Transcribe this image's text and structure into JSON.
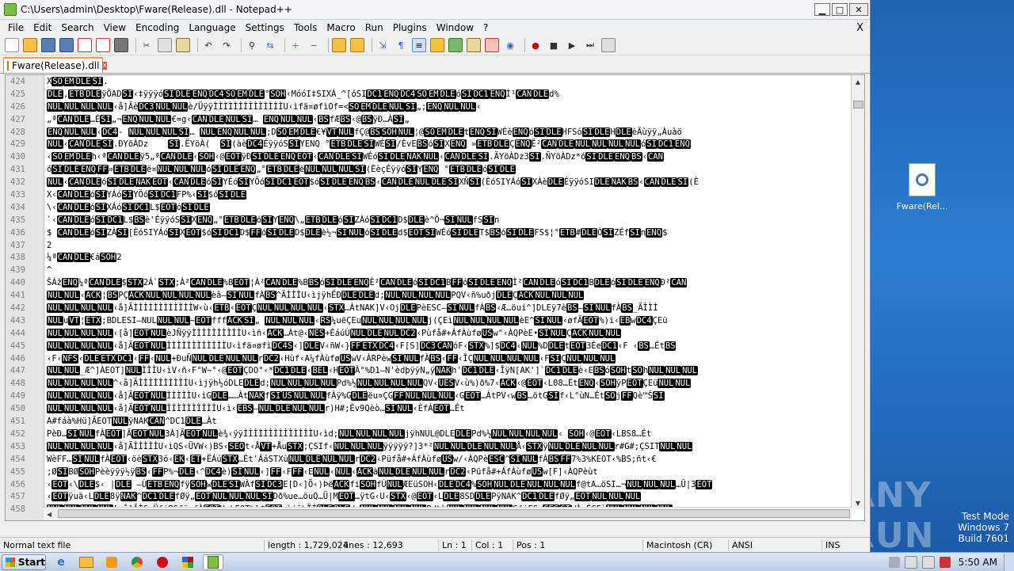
{
  "window": {
    "title": "C:\\Users\\admin\\Desktop\\Fware(Release).dll - Notepad++",
    "minimize": "▁",
    "maximize": "□",
    "close": "✕"
  },
  "menu": [
    "File",
    "Edit",
    "Search",
    "View",
    "Encoding",
    "Language",
    "Settings",
    "Tools",
    "Macro",
    "Run",
    "Plugins",
    "Window",
    "?"
  ],
  "menu_close": "X",
  "tab": {
    "label": "Fware(Release).dll",
    "close": "x"
  },
  "lines": [
    {
      "n": "424",
      "t": "X[SO][EM][DLE][SI]."
    },
    {
      "n": "425",
      "t": "[DLE]‚[ETB][DLE]ÿÖAD[SI]‹‡ÿÿÿó[SI][DLE][ENQ][DC4][SO][EM][DLE]°[SOH]‹MóóI‡SIXÁ_^[óSI[DC1][ENQ][DC4][SO][EM][DLE]ó[SI][DC1][ENQ]Ì¹[CAN][DLE]d%"
    },
    {
      "n": "426",
      "t": "[NUL][NUL][NUL][NUL]‹å]Ãè[DC3][NUL][NUL]è/ÜÿÿÌÌÌÌÌÌÌÌÌÌÌÌÌÌU‹ìfä¤øfìOf=<[SO][EM][DLE][NUL][SI]„;[ENQ][NUL][NUL]‹"
    },
    {
      "n": "427",
      "t": "„ª[CAN][DLE]…É[SI]„¬[ENQ][NUL][NUL]€=g‹[CAN][DLE][NUL][SI]… [ENQ][NUL][NUL]‹[BS]fÆ[BS]‹@[BS]ÿÐ…À[SI]„"
    },
    {
      "n": "428",
      "t": "[ENQ][NUL][NUL]‹[DC4]- [NUL][NUL][NUL][SI]… [NUL][ENQ][NUL][NUL];D[SO][EM][DLE]€¥[VT][NUL]fÇ@[BS][SOH][NUL]¦@[SO][EM][DLE]t[ENQ][SI]WÉè[ENQ]ó[SI][DLE]HFSó[SI][DLE]H[DLE]èÄùÿÿ„Àuàö"
    },
    {
      "n": "429",
      "t": "[NUL]‹[CAN][DLE][SI].ÐYöÀDz    [SI].ËYöÀ(  [SI](àè[DC4]ÉÿÿóS[SI]YENQ °[ETB][DLE][SI]WÉ[SI]/ÈvE[BS]ó[SI]X[ENQ] »[ETB][DLE]Ç[ENQ]Ë²[CAN][DLE][NUL][NUL][NUL][NUL]ó[SI][DC1][ENQ]"
    },
    {
      "n": "430",
      "t": "‹[SO][EM][DLE]h‹ª[CAN][DLE]ÿ5„ª[CAN][DLE]‹[SOH]‹@[EOT]ÿÐ[SI][DLE][ENQ][EOT]‹[CAN][DLE][SI]WÉó[SI][DLE][NAK][NUL]‹[CAN][DLE][SI].ÄYöÀDz3[SI].ÑYöÀDz*ó[SI][DLE][ENQ][BS]‹[CAN]"
    },
    {
      "n": "431",
      "t": "ó[SI][DLE][ENQ][FF]»[ETB][DLE]ë¤[NUL][NUL][NUL]ó[SI][DLE][ENQ]„°[ETB][DLE]ë[NUL][NUL][NUL][SI](ÈèçÉÿÿó[SI]Y[ENQ] °[ETB][DLE]ó[SI][DLE]"
    },
    {
      "n": "432",
      "t": "[NUL]‹[CAN][DLE]ó[SI][DLE][NAK][EOT]‹[CAN][DLE]ó[SI]YÉó[SI]YÖó[SI][DC1][EOT]$ó[SI][DLE][ENQ][BS]‹[CAN][DLE][NUL][DLE][SI]XÑ[SI](ÈóSIYÁó[SI]XÀè[DLE]ÉÿÿóSI[DLE][NAK][BS]‹[CAN][DLE][SI](È"
    },
    {
      "n": "433",
      "t": "X‹[CAN][DLE]ó[SI]YÁó[SI]YÖó[SI][DC1]FP%‹[SI]$ó[SI][DLE]"
    },
    {
      "n": "434",
      "t": "\\‹[CAN][DLE]ó[SI]XÁó[SI][DC1]L$[EOT]ó[SI][DLE]"
    },
    {
      "n": "435",
      "t": "`‹[CAN][DLE]ó[SI][DC1]L$[BS]è'ÉÿÿóS[SI]X[ENQ]„°[ETB][DLE]ó[SI]Y[ENQ]\\„[ETB][DLE]ó[SI]ZÀó[SI][DC1]D$[DLE]è^Ô¬[SI][NUL]fS[SI]n"
    },
    {
      "n": "436",
      "t": "$ [CAN][DLE]ó[SI]ZÀ[SI][ÈóSIYÁó[SI]X[EOT]$ó[SI][DC1]D$[FF]ó[SI][DLE]D$[DLE]è½¬[SI][NUL]ó[SI][DLE]d$[EOT][SI]WÉó[SI][DLE]T$[BS]ó[SI][DLE]FS$¦°[ETB]#[DLE]Ò[SI]ZÉf[SI]n[ENQ]$"
    },
    {
      "n": "437",
      "t": "2"
    },
    {
      "n": "438",
      "t": "¼ª[CAN][DLE]€á[SOH]2"
    },
    {
      "n": "439",
      "t": "^"
    },
    {
      "n": "440",
      "t": "ŠÁž[ENQ]¼ª[CAN][DLE]$[STX]2Á`[STX];À²[CAN][DLE]%B[EOT]¦À²[CAN][DLE]%B[BS]ó[SI][DLE][ENQ]È²[CAN][DLE]ó[SI][DC1]B[FF]ó[SI][DLE][ENQ]Ì²[CAN][DLE]ó[SI][DC1]B[DLE]ó[SI][DLE][ENQ]Ð²[CAN]"
    },
    {
      "n": "441",
      "t": "[NUL][NUL]‹[ACK]¦[BS]PÇ[ACK][NUL][NUL][NUL][NUL]èâ—[SI][NUL]fÀ[BS]^ÃÌÌÌU‹ìjÿhËÐ[DLE][DLE]d;[NUL][NUL][NUL][NUL]PQV‹ñ%uðj[DLE]Ç[ACK][NUL][NUL][NUL]"
    },
    {
      "n": "442",
      "t": "[NUL][NUL][NUL][NUL]‹å]ÃÌÌÌÌÌÌÌÌÌÌÌÌW‹ù‹[ETB]‹[EOT]Ç[NUL][NUL][NUL][NUL]‹[STX]…ÀtNAK]V‹Oj[DLE]PèESC—[SI][NUL]fÀ[BS]‹Æ…öuí^]DLEÿ7è[BS]—[SI][NUL]fÀ[BS]_ÃÌÌÌ"
    },
    {
      "n": "443",
      "t": "[NUL]u[VT]¦[ETX];BDLESI—NUL[NUL][NUL]~[EOT]fff[ACK][SI]„ [NUL][NUL][NUL]‹[RS]¼uëÇEu[NUL][NUL][NUL][NUL]j(ÇEì[NUL][NUL][NUL][NUL]èE^[SI][NUL]‹øfÄ[EOT]%)i‹[EB]w[DC4]ÇEü"
    },
    {
      "n": "444",
      "t": "[NUL][NUL][NUL][NUL]‹[å][EOT][NUL]èJÑÿÿÌÌÌÌÌÌÌÌÌÌU‹ìñ‹[ACK]…Àt@‹[NES]+ÉáúÙ[NUL][DLE][NUL][DC2]‹Pùfå#+ÁfÀùfø[US]w\"‹ÀQPèE•[SI][NUL]Ç[ACK][NUL][NUL]"
    },
    {
      "n": "445",
      "t": "[NUL][NUL][NUL][NUL]‹å]Ã[EOT][NUL]ÌÌÌÌÌÌÌÌÌÌÌÌU‹ìfä¤øfì[DC4S]‹][DLE]V‹ñW‹}[FF][ETX][DC4]‹F[S][DC3][CAN]óF‹[STX]%]$[DC4]‹[NUL]%D[DLE]t[EOT]3Ée[DC1]‹F ‹[BS]…Ét[BS]"
    },
    {
      "n": "446",
      "t": "‹F‹[NFS]‹[DLE][ETX][DC1]‹[FF]‹[NUL]+ÐuÑ[NUL][DLE][NUL][NUL]r[DC2]‹Hùf‹A¼fÀùfø[US]wV‹ÀRPèw[SI][NUL]fÀ[BS]‹[FF]‹ÎÇ[NUL][NUL][NUL][NUL]‹F[SI]Ç[NUL][NUL][NUL]"
    },
    {
      "n": "447",
      "t": "[NUL][NUL]_Æ^]ÀEOT][NUL]ÌÌÌU‹ìV‹ñ‹F°W~°‹@[EOT]ÇDO°‹*[DC1][DLE]‹[BEL]‹H[EOT]À°%D1—N'èdþÿÿN„ÿ[NAK]h'[DC1][DLE]‹ÎÿN[AK']`[DC1][DLE]è‹E[BS]ó[SOH]t[SO]h[NUL][NUL][NUL]"
    },
    {
      "n": "448",
      "t": "[NUL][NUL][NUL][NUL]^‹å]ÃÌÌÌÌÌÌÌÌÌÌU‹ìjÿh½óDLE[DLE]d;[NUL][NUL][NUL][NUL]Pd%½[NUL][NUL][NUL][NUL]QV‹[UES]V‹ù%)ð%7‹[ACK]‹@[EOT]‹L08…Ét[ENQ]‹[SOH]ÿP[EOT]ÇEü[NUL][NUL]"
    },
    {
      "n": "449",
      "t": "[NUL][NUL][NUL][NUL]‹å]Ã[EOT][NUL]ÌÌÌÌÌU‹ìG[DLE]……Àt[NAK]f[SI][US][NUL][NUL]fÀÿ%G[DLE]ëu¤ÇG[FF][NUL][NUL][NUL]‹G[EOT]…ÀtPV‹w[BS]…ötG[SI]f‹L°ùN…Ét[SO]j[FF]Qè™Š[SI]"
    },
    {
      "n": "450",
      "t": "[NUL][NUL][NUL][NUL]‹å]Ã[EOT][NUL]ÌÌÌÌÌÌÌÌÌÌU‹ì‹[EBS]—[NUL][DLE][NUL][NUL]r)H#;Èv9Qèò…[SI][NUL]‹ÈfÀ[EOT]…Ét"
    },
    {
      "n": "451",
      "t": "A#fáà%Hü]ÃEOT[NUL]ÿNAK[CAN]^DC1[DLE]…Àt"
    },
    {
      "n": "452",
      "t": "PèÐ…[SI][NUL]fÀ[EOT]]Ã[EOT][NUL]3À]Ã[EOT][NUL]è¾‹ÿÿÌÌÌÌÌÌÌÌÌÌÌÌÌÌU‹ìd;[NUL][NUL][NUL][NUL]jÿhNUL@DLE[DLE]Pd%½[NUL][NUL][NUL][NUL]‹ [SOH]‹@[EOT]‹LBS8…Ét"
    },
    {
      "n": "453",
      "t": "[NUL][NUL][NUL][NUL]‹å]ÃÌÌÌÌÌU‹ìQS‹ÜVW‹)BS‹[SEO]t‹Å[VT]+Åu[STX];ÇSIf‹[NUL][NUL][NUL]ÿÿÿÿÿ?]3*²[NUL][NUL][DLE][NUL][NUL]Å‹[STX]ÿ[NUL][DLE][NUL][NUL]r#G#;ÇSIT[NUL][NUL]"
    },
    {
      "n": "454",
      "t": "WèFF…[SI][NUL]fÀ[EOT]‹öè[STX]3ö‹[EK]‹[ET]+ËÁú[STX]…Ét'ÁáSTXù[NUL][DLE][NUL][NUL]r[DC2]‹Püfå#+ÁfÀùfø[US]w/‹ÀQPè[ESC]^[SI][NUL]fÀ[BS][FF]7%3%KEOT‹%BS;ñt‹€"
    },
    {
      "n": "455",
      "t": ";Ø[SI]BØ[SOH]Pèèÿÿÿ½ÿ[BS]‹[FF]P%¬[DLE]‹^[DC4]è)[SI][NUL]‹][FF]‹F[FF]‹E[NUL]‹[NUL]‹[ACK]à[NUL][DLE][NUL][NUL]r[DC2]‹Püfå#+ÁfÀùfø[US]w[F]‹ÀQPèùt"
    },
    {
      "n": "456",
      "t": "‹[EOT]‹\\[DLE]$‹ |[DLE] —Ù[ETB][ENQ]fÿ[SOH]w[DLE][SI]WÀf[SI][DC3]E[D‹]Ö‹)Þë[ACK]fi[SOH]fÙ[NUL]ÆEüSOH‹[DLE][DC4]%[SOH][NUL][DLE][NUL][NUL][NUL]f@tA…öSI…¬[NUL][NUL][NUL]…Û|3[EOT]"
    },
    {
      "n": "457",
      "t": "‹[EOT]ÿuä‹L[DLE]8ÿ[NAK]^[DC1][DLE]fØÿ„[EOT][NUL][NUL][NUL][SI]Dð%ue…öuQ…Ü|M[EOT]…ÿtG‹U‹[STX]‹@[EOT]‹L[DLE]8SD[DLE]PÿNAK^[DC1][DLE]fØÿ„[EOT][NUL][NUL][NUL]"
    },
    {
      "n": "458",
      "t": "[NUL][NUL][NUL][NUL][‹å]ÃÌS‹ÜfiBSfä¤fÀ[EOT]U‹kEOT‰l$[EOT]‹ìjÿhÏÍ[DLE][DLE]d;[NUL][NUL][NUL][NUL]Pd%½[NUL][NUL][NUL][NUL]SfiFS‹[SES][SI]WÀ‹ÉÇEè[NUL][NUL][NUL][NUL]"
    }
  ],
  "status": {
    "type": "Normal text file",
    "length": "length : 1,729,024",
    "lines": "lines : 12,693",
    "ln": "Ln : 1",
    "col": "Col : 1",
    "pos": "Pos : 1",
    "eol": "Macintosh (CR)",
    "enc": "ANSI",
    "ins": "INS"
  },
  "desktop_icon": {
    "label": "Fware(Rel..."
  },
  "watermark": {
    "line1": "Test Mode",
    "line2": "Windows 7",
    "line3": "Build 7601",
    "brand": "ANY RUN"
  },
  "taskbar": {
    "start": "Start",
    "clock": "5:50 AM"
  }
}
